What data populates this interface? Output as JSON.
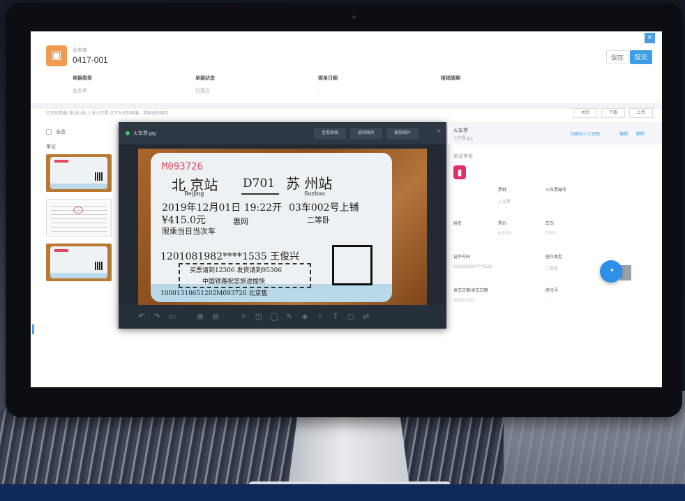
{
  "header": {
    "doc_type": "业务单",
    "doc_no": "0417-001",
    "close_icon": "×",
    "btn_secondary": "保存",
    "btn_primary": "提交",
    "fields": [
      {
        "label": "单据类型",
        "value": "业务单"
      },
      {
        "label": "单据状态",
        "value": "已提交"
      },
      {
        "label": "提单日期",
        "value": "-"
      },
      {
        "label": "报销周期",
        "value": ""
      }
    ]
  },
  "notice": "已识别单据1张(共1张)  1 张火车票  以下为识别结果，请核对后保存",
  "toolbar": {
    "btn1": "关闭",
    "btn2": "下载",
    "btn3": "上传"
  },
  "left": {
    "select_all": "全选",
    "group": "单证"
  },
  "viewer": {
    "title": "火车票.jpg",
    "btn1": "查看原图",
    "btn2": "旋转图片",
    "btn3": "裁剪图片",
    "close": "×"
  },
  "ticket": {
    "serial": "M093726",
    "from": "北 京站",
    "from_pinyin": "Beijing",
    "train_no": "D701",
    "to": "苏  州站",
    "to_pinyin": "Suzhou",
    "date_time": "2019年12月01日 19:22开",
    "seat": "03车002号上铺",
    "price": "¥415.0元",
    "sold_by": "惠网",
    "class": "二等卧",
    "note": "限乘当日当次车",
    "id_name": "1201081982****1535 王俊兴",
    "box_line1": "买票请到12306 发货请到95306",
    "box_line2": "中国铁路祝您旅途愉快",
    "bottom": "10001310651202M093726 北京售"
  },
  "tools": [
    "↶",
    "↷",
    "▭",
    "⊞",
    "⊟",
    "⌗",
    "◫",
    "◯",
    "✎",
    "◈",
    "☆",
    "T",
    "◻",
    "⇄"
  ],
  "detail": {
    "title": "火车票",
    "subtitle": "火车票.jpg",
    "link1": "切换到人工识别",
    "link2": "编辑",
    "link3": "删除",
    "section": "单证类型",
    "train_icon": "🚆",
    "fields": [
      {
        "k": "票种",
        "v": "火车票"
      },
      {
        "k": "火车票编号",
        "v": "-"
      },
      {
        "k": "姓名",
        "v": ""
      },
      {
        "k": "票价",
        "v": "415.00"
      },
      {
        "k": "车次",
        "v": "D701"
      },
      {
        "k": "证件号码",
        "v": "1201081982****1535"
      },
      {
        "k": "座位类型",
        "v": "二等座"
      },
      {
        "k": "发车日期/发车日期",
        "v": "2019/12/01"
      },
      {
        "k": "座位号",
        "v": "-"
      }
    ]
  },
  "chat_icon": "◔"
}
